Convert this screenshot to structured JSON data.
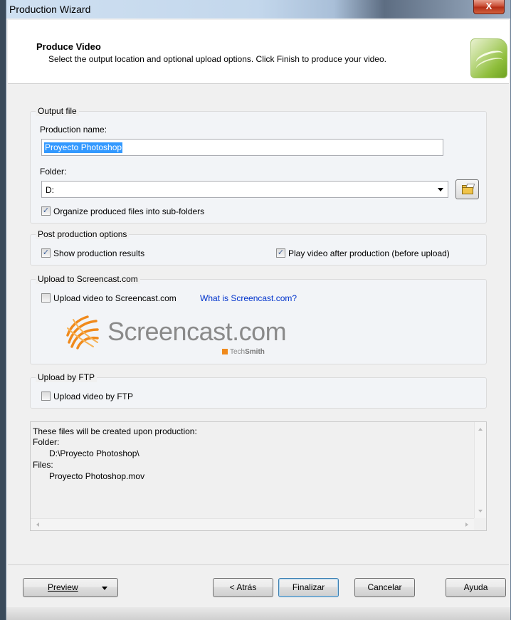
{
  "window": {
    "title": "Production Wizard",
    "close_glyph": "X"
  },
  "header": {
    "title": "Produce Video",
    "subtitle": "Select the output location and optional upload options. Click Finish to produce your video."
  },
  "output_file": {
    "legend": "Output file",
    "production_name_label": "Production name:",
    "production_name_value": "Proyecto Photoshop",
    "folder_label": "Folder:",
    "folder_value": "D:",
    "browse_icon": "folder-open-icon",
    "organize_label": "Organize produced files into sub-folders",
    "organize_checked": true
  },
  "post_production": {
    "legend": "Post production options",
    "show_results_label": "Show production results",
    "show_results_checked": true,
    "play_video_label": "Play video after production (before upload)",
    "play_video_checked": true
  },
  "screencast": {
    "legend": "Upload to Screencast.com",
    "upload_label": "Upload video to Screencast.com",
    "upload_checked": false,
    "link": "What is Screencast.com?",
    "logo_text": "Screencast.com",
    "techsmith_prefix": "Tech",
    "techsmith_bold": "Smith"
  },
  "ftp": {
    "legend": "Upload by FTP",
    "upload_label": "Upload video by FTP",
    "upload_checked": false
  },
  "info": {
    "line1": "These files will be created upon production:",
    "line2": "Folder:",
    "line3": "D:\\Proyecto Photoshop\\",
    "line4": "Files:",
    "line5": "Proyecto Photoshop.mov"
  },
  "buttons": {
    "preview": "Preview",
    "back": "< Atrás",
    "finish": "Finalizar",
    "cancel": "Cancelar",
    "help": "Ayuda"
  },
  "colors": {
    "selection": "#3399ff",
    "link": "#0033cc",
    "screencast_orange": "#f08a1c"
  }
}
